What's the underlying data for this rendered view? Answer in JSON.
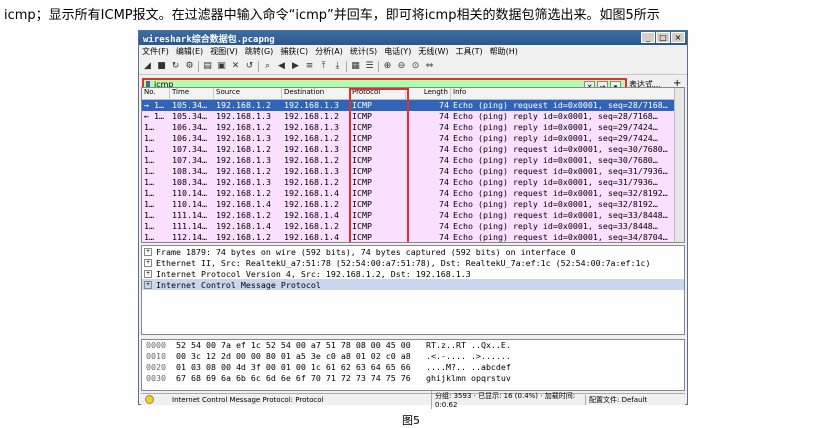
{
  "caption_top": "icmp；显示所有ICMP报文。在过滤器中输入命令“icmp”并回车，即可将icmp相关的数据包筛选出来。如图5所示",
  "caption_bottom": "图5",
  "window": {
    "title": "wireshark综合数据包.pcapng",
    "menu": [
      "文件(F)",
      "编辑(E)",
      "视图(V)",
      "跳转(G)",
      "捕获(C)",
      "分析(A)",
      "统计(S)",
      "电话(Y)",
      "无线(W)",
      "工具(T)",
      "帮助(H)"
    ],
    "filter_value": "icmp",
    "expression_label": "表达式…",
    "plus_label": "+"
  },
  "columns": [
    "No.",
    "Time",
    "Source",
    "Destination",
    "Protocol",
    "Length",
    "Info"
  ],
  "packets": [
    [
      "→ 1…",
      "105.34…",
      "192.168.1.2",
      "192.168.1.3",
      "ICMP",
      "74",
      "Echo (ping) request  id=0x0001, seq=28/7168…"
    ],
    [
      "← 1…",
      "105.34…",
      "192.168.1.3",
      "192.168.1.2",
      "ICMP",
      "74",
      "Echo (ping) reply    id=0x0001, seq=28/7168…"
    ],
    [
      "  1…",
      "106.34…",
      "192.168.1.2",
      "192.168.1.3",
      "ICMP",
      "74",
      "Echo (ping) reply    id=0x0001, seq=29/7424…"
    ],
    [
      "  1…",
      "106.34…",
      "192.168.1.3",
      "192.168.1.2",
      "ICMP",
      "74",
      "Echo (ping) reply    id=0x0001, seq=29/7424…"
    ],
    [
      "  1…",
      "107.34…",
      "192.168.1.2",
      "192.168.1.3",
      "ICMP",
      "74",
      "Echo (ping) request  id=0x0001, seq=30/7680…"
    ],
    [
      "  1…",
      "107.34…",
      "192.168.1.3",
      "192.168.1.2",
      "ICMP",
      "74",
      "Echo (ping) reply    id=0x0001, seq=30/7680…"
    ],
    [
      "  1…",
      "108.34…",
      "192.168.1.2",
      "192.168.1.3",
      "ICMP",
      "74",
      "Echo (ping) request  id=0x0001, seq=31/7936…"
    ],
    [
      "  1…",
      "108.34…",
      "192.168.1.3",
      "192.168.1.2",
      "ICMP",
      "74",
      "Echo (ping) reply    id=0x0001, seq=31/7936…"
    ],
    [
      "  1…",
      "110.14…",
      "192.168.1.2",
      "192.168.1.4",
      "ICMP",
      "74",
      "Echo (ping) request  id=0x0001, seq=32/8192…"
    ],
    [
      "  1…",
      "110.14…",
      "192.168.1.4",
      "192.168.1.2",
      "ICMP",
      "74",
      "Echo (ping) reply    id=0x0001, seq=32/8192…"
    ],
    [
      "  1…",
      "111.14…",
      "192.168.1.2",
      "192.168.1.4",
      "ICMP",
      "74",
      "Echo (ping) request  id=0x0001, seq=33/8448…"
    ],
    [
      "  1…",
      "111.14…",
      "192.168.1.4",
      "192.168.1.2",
      "ICMP",
      "74",
      "Echo (ping) reply    id=0x0001, seq=33/8448…"
    ],
    [
      "  1…",
      "112.14…",
      "192.168.1.2",
      "192.168.1.4",
      "ICMP",
      "74",
      "Echo (ping) request  id=0x0001, seq=34/8704…"
    ]
  ],
  "details": [
    "Frame 1879: 74 bytes on wire (592 bits), 74 bytes captured (592 bits) on interface 0",
    "Ethernet II, Src: RealtekU_a7:51:78 (52:54:00:a7:51:78), Dst: RealtekU_7a:ef:1c (52:54:00:7a:ef:1c)",
    "Internet Protocol Version 4, Src: 192.168.1.2, Dst: 192.168.1.3",
    "Internet Control Message Protocol"
  ],
  "hex": [
    [
      "0000",
      "52 54 00 7a ef 1c 52 54  00 a7 51 78 08 00 45 00",
      "RT.z..RT ..Qx..E."
    ],
    [
      "0010",
      "00 3c 12 2d 00 00 80 01  a5 3e c0 a8 01 02 c0 a8",
      ".<.-.... .>......"
    ],
    [
      "0020",
      "01 03 08 00 4d 3f 00 01  00 1c 61 62 63 64 65 66",
      "....M?.. ..abcdef"
    ],
    [
      "0030",
      "67 68 69 6a 6b 6c 6d 6e  6f 70 71 72 73 74 75 76",
      "ghijklmn opqrstuv"
    ]
  ],
  "status": {
    "left": "Internet Control Message Protocol: Protocol",
    "middle": "分组: 3593 · 已显示: 16 (0.4%) · 加载时间: 0:0.62",
    "right": "配置文件: Default"
  },
  "colors": {
    "filter_ok": "#afffaf",
    "icmp_row": "#fce0ff",
    "selected_row": "#2f64b8",
    "highlight": "#e03030"
  }
}
